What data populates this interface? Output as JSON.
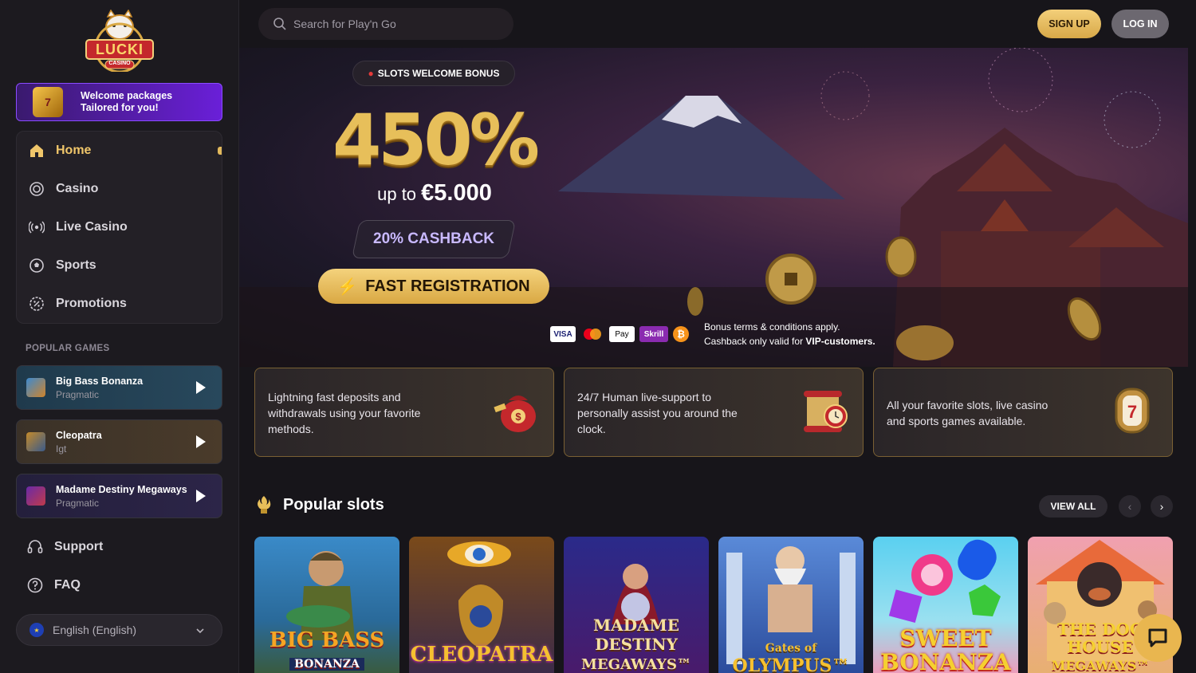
{
  "logo": {
    "text": "LUCKI",
    "sub": "CASINO"
  },
  "welcome": {
    "title": "Welcome packages",
    "subtitle": "Tailored for you!"
  },
  "nav": {
    "items": [
      {
        "label": "Home",
        "icon": "home-icon",
        "active": true
      },
      {
        "label": "Casino",
        "icon": "casino-chip-icon"
      },
      {
        "label": "Live Casino",
        "icon": "live-broadcast-icon"
      },
      {
        "label": "Sports",
        "icon": "soccer-ball-icon"
      },
      {
        "label": "Promotions",
        "icon": "percent-badge-icon"
      }
    ]
  },
  "popular_games": {
    "title": "POPULAR GAMES",
    "items": [
      {
        "name": "Big Bass Bonanza",
        "provider": "Pragmatic"
      },
      {
        "name": "Cleopatra",
        "provider": "Igt"
      },
      {
        "name": "Madame Destiny Megaways",
        "provider": "Pragmatic"
      }
    ]
  },
  "support": {
    "support_label": "Support",
    "faq_label": "FAQ"
  },
  "language": {
    "label": "English (English)"
  },
  "search": {
    "placeholder": "Search for Play'n Go"
  },
  "header": {
    "signup_label": "SIGN UP",
    "login_label": "LOG IN"
  },
  "hero": {
    "badge": "SLOTS WELCOME BONUS",
    "percent": "450%",
    "upto_prefix": "up to",
    "upto_amount": "€5.000",
    "cashback": "20% CASHBACK",
    "cta": "FAST REGISTRATION",
    "payments": [
      "VISA",
      "Mastercard",
      "Pay",
      "Skrill",
      "Bitcoin"
    ],
    "terms_line1": "Bonus terms & conditions apply.",
    "terms_line2_prefix": "Cashback only valid for ",
    "terms_line2_bold": "VIP-customers."
  },
  "features": [
    {
      "text": "Lightning fast deposits and withdrawals using your favorite methods.",
      "icon": "money-bag-icon"
    },
    {
      "text": "24/7 Human live-support to personally assist you around the clock.",
      "icon": "scroll-clock-icon"
    },
    {
      "text": "All your favorite slots, live casino and sports games available.",
      "icon": "slot-reel-icon"
    }
  ],
  "popular_slots": {
    "title": "Popular slots",
    "view_all": "VIEW ALL",
    "games": [
      {
        "title": "BIG BASS",
        "subtitle": "BONANZA"
      },
      {
        "title": "CLEOPATRA",
        "subtitle": ""
      },
      {
        "title": "MADAME DESTINY",
        "subtitle": "MEGAWAYS™"
      },
      {
        "title": "Gates of",
        "subtitle": "OLYMPUS™"
      },
      {
        "title": "SWEET",
        "subtitle": "BONANZA"
      },
      {
        "title": "THE DOG HOUSE",
        "subtitle": "MEGAWAYS™"
      }
    ]
  },
  "colors": {
    "accent": "#e7bf5a",
    "background": "#17151a",
    "sidebar": "#1c1a1f",
    "purple": "#6a1fd8"
  }
}
